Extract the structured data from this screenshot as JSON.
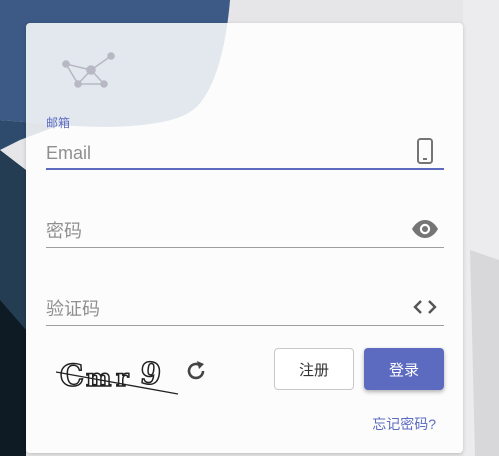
{
  "email_field": {
    "label": "邮箱",
    "placeholder": "Email",
    "adornment_icon": "smartphone-icon"
  },
  "password_field": {
    "placeholder": "密码",
    "adornment_icon": "eye-icon"
  },
  "captcha_field": {
    "placeholder": "验证码",
    "adornment_icon": "code-brackets-icon"
  },
  "captcha_image": {
    "text": "Cmr9"
  },
  "buttons": {
    "register_label": "注册",
    "login_label": "登录"
  },
  "links": {
    "forgot_password": "忘记密码?"
  },
  "colors": {
    "primary": "#5c6bc0",
    "underline": "#9e9e9e"
  }
}
